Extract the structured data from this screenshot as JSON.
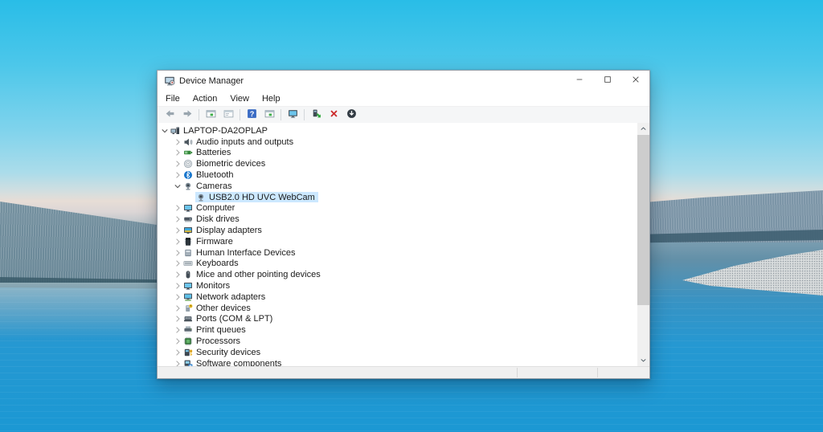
{
  "desktop": {
    "colors": {
      "sky_top": "#29bde7",
      "horizon": "#e7ddd6",
      "water_bottom": "#1b98d3",
      "hill": "#74909f",
      "gravel": "#d4d8d9"
    }
  },
  "window": {
    "title": "Device Manager",
    "title_icon": "device-manager",
    "controls": [
      {
        "icon": "minimize",
        "name": "minimize-button"
      },
      {
        "icon": "maximize",
        "name": "maximize-button"
      },
      {
        "icon": "close",
        "name": "close-button"
      }
    ],
    "menubar": [
      "File",
      "Action",
      "View",
      "Help"
    ],
    "toolbar": [
      {
        "type": "button",
        "icon": "back-arrow"
      },
      {
        "type": "button",
        "icon": "forward-arrow"
      },
      {
        "type": "separator"
      },
      {
        "type": "button",
        "icon": "console-window"
      },
      {
        "type": "button",
        "icon": "properties-window"
      },
      {
        "type": "separator"
      },
      {
        "type": "button",
        "icon": "help"
      },
      {
        "type": "button",
        "icon": "console-window"
      },
      {
        "type": "separator"
      },
      {
        "type": "button",
        "icon": "scan-hardware"
      },
      {
        "type": "separator"
      },
      {
        "type": "button",
        "icon": "update-driver"
      },
      {
        "type": "button",
        "icon": "uninstall"
      },
      {
        "type": "button",
        "icon": "disable-device"
      }
    ],
    "statusbar_text": ""
  },
  "tree": {
    "selection_color": "#cce8ff",
    "items": [
      {
        "label": "LAPTOP-DA2OPLAP",
        "icon": "computer-root",
        "level": 0,
        "state": "expanded",
        "selected": false
      },
      {
        "label": "Audio inputs and outputs",
        "icon": "speaker",
        "level": 1,
        "state": "collapsed",
        "selected": false
      },
      {
        "label": "Batteries",
        "icon": "battery",
        "level": 1,
        "state": "collapsed",
        "selected": false
      },
      {
        "label": "Biometric devices",
        "icon": "fingerprint",
        "level": 1,
        "state": "collapsed",
        "selected": false
      },
      {
        "label": "Bluetooth",
        "icon": "bluetooth",
        "level": 1,
        "state": "collapsed",
        "selected": false
      },
      {
        "label": "Cameras",
        "icon": "camera",
        "level": 1,
        "state": "expanded",
        "selected": false
      },
      {
        "label": "USB2.0 HD UVC WebCam",
        "icon": "webcam",
        "level": 2,
        "state": "leaf",
        "selected": true
      },
      {
        "label": "Computer",
        "icon": "monitor",
        "level": 1,
        "state": "collapsed",
        "selected": false
      },
      {
        "label": "Disk drives",
        "icon": "disk",
        "level": 1,
        "state": "collapsed",
        "selected": false
      },
      {
        "label": "Display adapters",
        "icon": "display",
        "level": 1,
        "state": "collapsed",
        "selected": false
      },
      {
        "label": "Firmware",
        "icon": "firmware",
        "level": 1,
        "state": "collapsed",
        "selected": false
      },
      {
        "label": "Human Interface Devices",
        "icon": "hid",
        "level": 1,
        "state": "collapsed",
        "selected": false
      },
      {
        "label": "Keyboards",
        "icon": "keyboard",
        "level": 1,
        "state": "collapsed",
        "selected": false
      },
      {
        "label": "Mice and other pointing devices",
        "icon": "mouse",
        "level": 1,
        "state": "collapsed",
        "selected": false
      },
      {
        "label": "Monitors",
        "icon": "monitor",
        "level": 1,
        "state": "collapsed",
        "selected": false
      },
      {
        "label": "Network adapters",
        "icon": "network",
        "level": 1,
        "state": "collapsed",
        "selected": false
      },
      {
        "label": "Other devices",
        "icon": "unknown-device",
        "level": 1,
        "state": "collapsed",
        "selected": false
      },
      {
        "label": "Ports (COM & LPT)",
        "icon": "ports",
        "level": 1,
        "state": "collapsed",
        "selected": false
      },
      {
        "label": "Print queues",
        "icon": "printer",
        "level": 1,
        "state": "collapsed",
        "selected": false
      },
      {
        "label": "Processors",
        "icon": "processor",
        "level": 1,
        "state": "collapsed",
        "selected": false
      },
      {
        "label": "Security devices",
        "icon": "security",
        "level": 1,
        "state": "collapsed",
        "selected": false
      },
      {
        "label": "Software components",
        "icon": "software",
        "level": 1,
        "state": "collapsed",
        "selected": false
      }
    ]
  }
}
